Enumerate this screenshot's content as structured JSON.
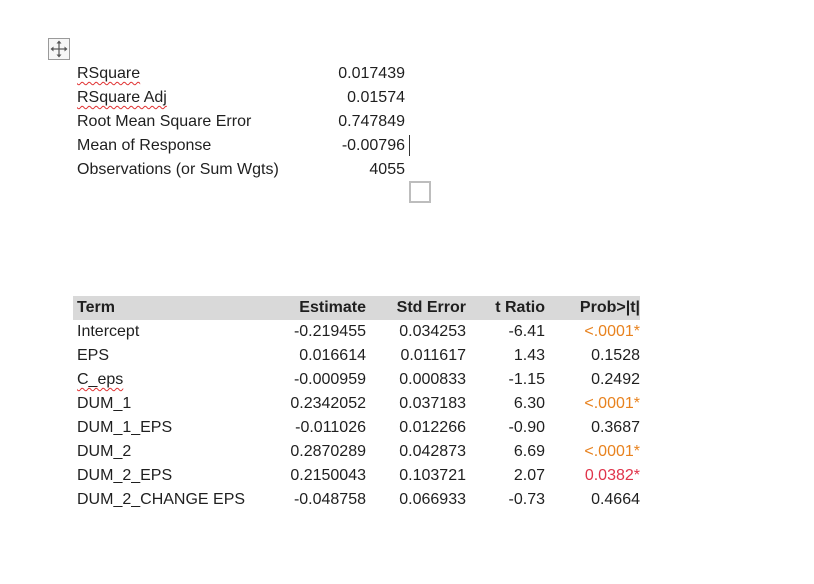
{
  "summary_of_fit": [
    {
      "label": "RSquare",
      "value": "0.017439",
      "flagged": true
    },
    {
      "label": "RSquare Adj",
      "value": "0.01574",
      "flagged": true
    },
    {
      "label": "Root Mean Square Error",
      "value": "0.747849",
      "flagged": false
    },
    {
      "label": "Mean of Response",
      "value": "-0.00796",
      "flagged": false
    },
    {
      "label": "Observations (or Sum Wgts)",
      "value": "4055",
      "flagged": false
    }
  ],
  "parameter_estimates": {
    "headers": {
      "term": "Term",
      "estimate": "Estimate",
      "std_error": "Std Error",
      "t_ratio": "t Ratio",
      "prob": "Prob>|t|"
    },
    "rows": [
      {
        "term": "Intercept",
        "estimate": "-0.219455",
        "std_error": "0.034253",
        "t_ratio": "-6.41",
        "prob": "<.0001*",
        "sig": "orange"
      },
      {
        "term": "EPS",
        "estimate": "0.016614",
        "std_error": "0.011617",
        "t_ratio": "1.43",
        "prob": "0.1528",
        "sig": "none"
      },
      {
        "term": "C_eps",
        "estimate": "-0.000959",
        "std_error": "0.000833",
        "t_ratio": "-1.15",
        "prob": "0.2492",
        "sig": "none"
      },
      {
        "term": "DUM_1",
        "estimate": "0.2342052",
        "std_error": "0.037183",
        "t_ratio": "6.30",
        "prob": "<.0001*",
        "sig": "orange"
      },
      {
        "term": "DUM_1_EPS",
        "estimate": "-0.011026",
        "std_error": "0.012266",
        "t_ratio": "-0.90",
        "prob": "0.3687",
        "sig": "none"
      },
      {
        "term": "DUM_2",
        "estimate": "0.2870289",
        "std_error": "0.042873",
        "t_ratio": "6.69",
        "prob": "<.0001*",
        "sig": "orange"
      },
      {
        "term": "DUM_2_EPS",
        "estimate": "0.2150043",
        "std_error": "0.103721",
        "t_ratio": "2.07",
        "prob": "0.0382*",
        "sig": "red"
      },
      {
        "term": "DUM_2_CHANGE EPS",
        "estimate": "-0.048758",
        "std_error": "0.066933",
        "t_ratio": "-0.73",
        "prob": "0.4664",
        "sig": "none"
      }
    ]
  },
  "colors": {
    "header_bg": "#d9d9d9",
    "sig_orange": "#e8821e",
    "sig_red": "#e0334a",
    "spellcheck": "#e03030"
  },
  "icons": {
    "table_move_handle": "four-way-arrow-icon",
    "anchor": "empty-square-icon"
  }
}
